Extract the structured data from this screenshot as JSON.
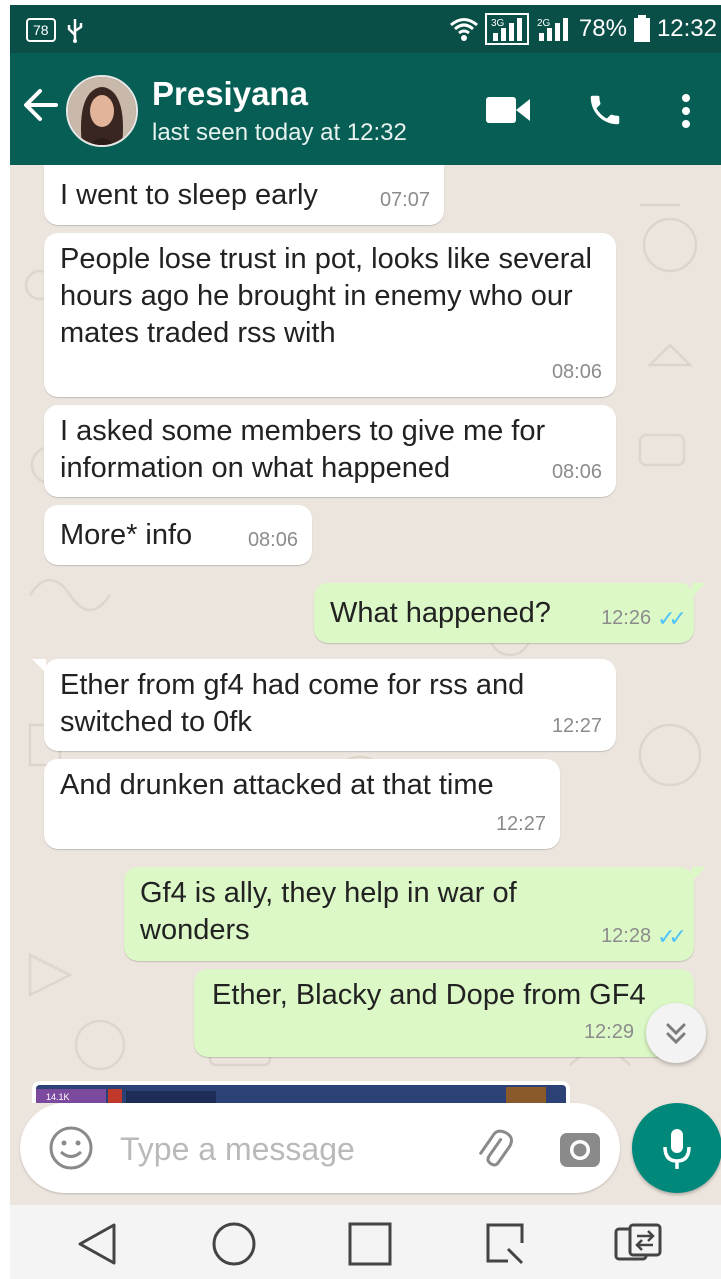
{
  "status_bar": {
    "notification_badge": "78",
    "battery": "78%",
    "time": "12:32",
    "net_1": "3G",
    "net_2": "2G"
  },
  "header": {
    "contact_name": "Presiyana",
    "last_seen": "last seen today at 12:32"
  },
  "messages": [
    {
      "direction": "in",
      "text": "I went to sleep early",
      "time": "07:07"
    },
    {
      "direction": "in",
      "text": "People lose trust in pot, looks like several hours ago he brought in enemy who our mates traded rss with",
      "time": "08:06"
    },
    {
      "direction": "in",
      "text": "I asked some members to give me for information on what happened",
      "time": "08:06"
    },
    {
      "direction": "in",
      "text": "More* info",
      "time": "08:06"
    },
    {
      "direction": "out",
      "text": "What happened?",
      "time": "12:26",
      "read": true
    },
    {
      "direction": "in",
      "text": "Ether from gf4 had come for rss and switched to 0fk",
      "time": "12:27"
    },
    {
      "direction": "in",
      "text": "And drunken attacked at that time",
      "time": "12:27"
    },
    {
      "direction": "out",
      "text": "Gf4 is ally, they help in war of wonders",
      "time": "12:28",
      "read": true
    },
    {
      "direction": "out",
      "text": "Ether, Blacky and Dope from GF4",
      "time": "12:29",
      "read": true
    }
  ],
  "preview_image_text": "14.1K",
  "composer": {
    "placeholder": "Type a message"
  },
  "icons": {
    "back": "arrow-back-icon",
    "video": "video-call-icon",
    "call": "phone-icon",
    "menu": "more-vert-icon",
    "emoji": "emoji-icon",
    "attach": "paperclip-icon",
    "camera": "camera-icon",
    "mic": "mic-icon",
    "scroll": "chevron-double-down-icon"
  },
  "colors": {
    "header": "#075e54",
    "status_bar": "#0a4f47",
    "outgoing_bubble": "#dcf8c6",
    "incoming_bubble": "#ffffff",
    "chat_background": "#ece5dd",
    "read_ticks": "#4fc3f7",
    "mic_button": "#00897b"
  }
}
